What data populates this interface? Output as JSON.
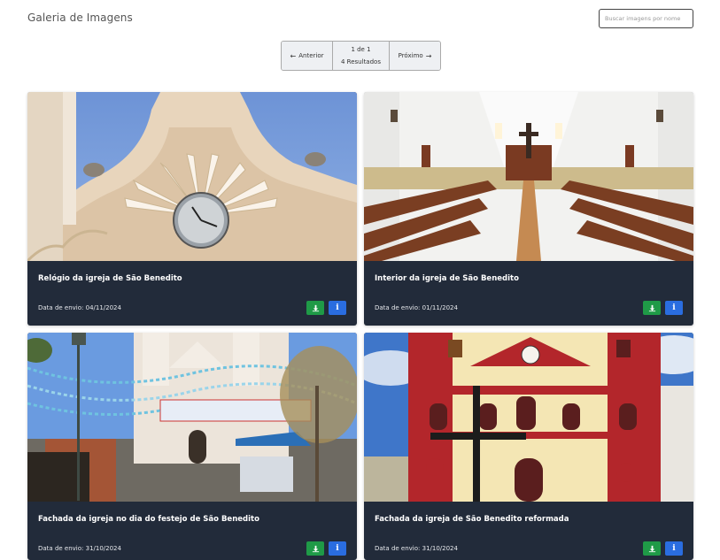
{
  "header": {
    "title": "Galeria de Imagens",
    "search_placeholder": "Buscar imagens por nome"
  },
  "pagination": {
    "prev_label": "Anterior",
    "page_info": "1 de 1",
    "results_info": "4 Resultados",
    "next_label": "Próximo"
  },
  "cards": [
    {
      "title": "Relógio da igreja de São Benedito",
      "date": "Data de envio: 04/11/2024",
      "image_icon": "church-clock-image"
    },
    {
      "title": "Interior da igreja de São Benedito",
      "date": "Data de envio: 01/11/2024",
      "image_icon": "church-interior-image"
    },
    {
      "title": "Fachada da igreja no dia do festejo de São Benedito",
      "date": "Data de envio: 31/10/2024",
      "image_icon": "festival-facade-image"
    },
    {
      "title": "Fachada da igreja de São Benedito reformada",
      "date": "Data de envio: 31/10/2024",
      "image_icon": "renovated-facade-image"
    }
  ],
  "colors": {
    "card_bg": "#222b3a",
    "download_button": "#1f9a47",
    "info_button": "#2a6de0"
  },
  "icons": {
    "download": "download-icon",
    "info": "info-icon",
    "prev": "arrow-left-icon",
    "next": "arrow-right-icon"
  }
}
